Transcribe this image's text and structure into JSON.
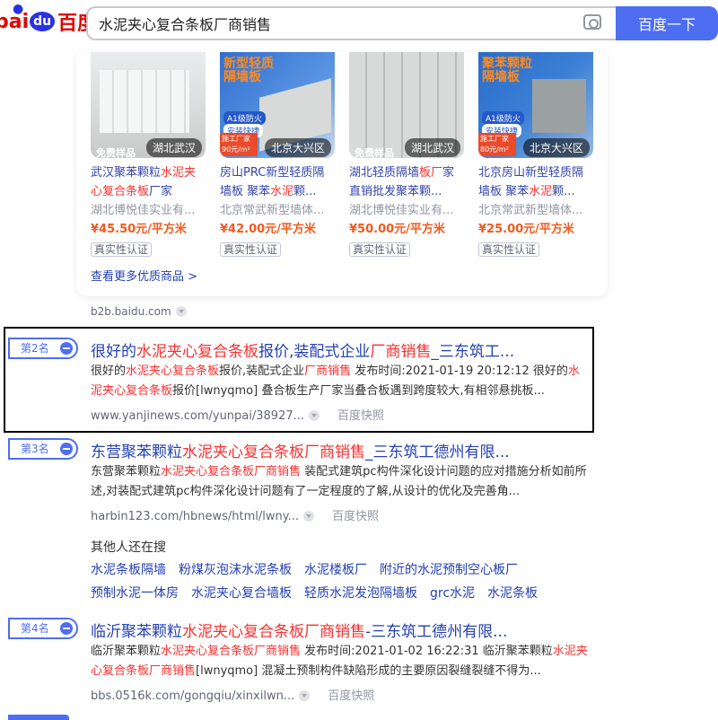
{
  "header": {
    "logo_bai": "bai",
    "logo_du": "du",
    "logo_cn": "百度",
    "query": "水泥夹心复合条板厂商销售",
    "search_button": "百度一下"
  },
  "products": [
    {
      "overlay": "",
      "badge_text": "",
      "free": "免费样品",
      "location": "湖北武汉",
      "title_a": "武汉聚苯颗粒",
      "title_r": "水泥夹心复合条板",
      "title_b": "厂家",
      "seller": "湖北博悦佳实业有...",
      "price": "¥45.50元/平方米",
      "verify": "真实性认证"
    },
    {
      "overlay": "新型轻质隔墙板",
      "badge_text": "A1级防火",
      "badge2_text": "安装快捷",
      "tag_a": "施工厂家",
      "tag_b": "90元/m²",
      "location": "北京大兴区",
      "title_a": "房山PRC新型轻质隔墙板 聚苯",
      "title_r": "水泥",
      "title_b": "颗...",
      "seller": "北京常武新型墙体...",
      "price": "¥42.00元/平方米",
      "verify": "真实性认证"
    },
    {
      "overlay": "",
      "free": "免费样品",
      "location": "湖北武汉",
      "title_a": "湖北轻质隔墙",
      "title_r": "板厂",
      "title_b": "家直销批发聚苯颗...",
      "seller": "湖北博悦佳实业有...",
      "price": "¥50.00元/平方米",
      "verify": "真实性认证"
    },
    {
      "overlay": "聚苯颗粒隔墙板",
      "badge_text": "A1级防火",
      "badge2_text": "安装快捷",
      "tag_a": "施工厂家",
      "tag_b": "80元/m²",
      "location": "北京大兴区",
      "title_a": "北京房山新型轻质隔墙板 聚苯",
      "title_r": "水泥",
      "title_b": "颗...",
      "seller": "北京常武新型墙体...",
      "price": "¥25.00元/平方米",
      "verify": "真实性认证"
    }
  ],
  "more_link": "查看更多优质商品 >",
  "card_source": "b2b.baidu.com",
  "results": [
    {
      "rank": "第2名",
      "title": [
        "很好的",
        "水泥夹心复合条板",
        "报价,装配式企业",
        "厂商销售",
        "_三东筑工..."
      ],
      "abstract": [
        "很好的",
        "水泥夹心复合条板",
        "报价,装配式企业",
        "厂商销售",
        " 发布时间:2021-01-19 20:12:12 很好的",
        "水泥夹心复合条板",
        "报价[lwnyqmo] 叠合板生产厂家当叠合板遇到跨度较大,有相邻悬挑板..."
      ],
      "url": "www.yanjinews.com/yunpai/38927...",
      "snapshot": "百度快照"
    },
    {
      "rank": "第3名",
      "title": [
        "东营聚苯颗粒",
        "水泥夹心复合条板厂商销售",
        "_三东筑工德州有限...",
        "",
        ""
      ],
      "abstract": [
        "东营聚苯颗粒",
        "水泥夹心复合条板厂商销售",
        " 装配式建筑pc构件深化设计问题的应对措施分析如前所述,对装配式建筑pc构件深化设计问题有了一定程度的了解,从设计的优化及完善角...",
        "",
        "",
        "",
        ""
      ],
      "url": "harbin123.com/hbnews/html/lwny...",
      "snapshot": "百度快照"
    },
    {
      "rank": "第4名",
      "title": [
        "临沂聚苯颗粒",
        "水泥夹心复合条板厂商销售",
        "-三东筑工德州有限...",
        "",
        ""
      ],
      "abstract": [
        "临沂聚苯颗粒",
        "水泥夹心复合条板厂商销售",
        " 发布时间:2021-01-02 16:22:31 临沂聚苯颗粒",
        "水泥夹心复合条板厂商销售",
        "[lwnyqmo] 混凝土预制构件缺陷形成的主要原因裂缝裂缝不得为...",
        "",
        ""
      ],
      "url": "bbs.0516k.com/gongqiu/xinxilwn...",
      "snapshot": "百度快照"
    }
  ],
  "others_heading": "其他人还在搜",
  "others_row1": [
    "水泥条板隔墙",
    "粉煤灰泡沫水泥条板",
    "水泥楼板厂",
    "附近的水泥预制空心板厂"
  ],
  "others_row2": [
    "预制水泥一体房",
    "水泥夹心复合墙板",
    "轻质水泥发泡隔墙板",
    "grc水泥",
    "水泥条板"
  ]
}
